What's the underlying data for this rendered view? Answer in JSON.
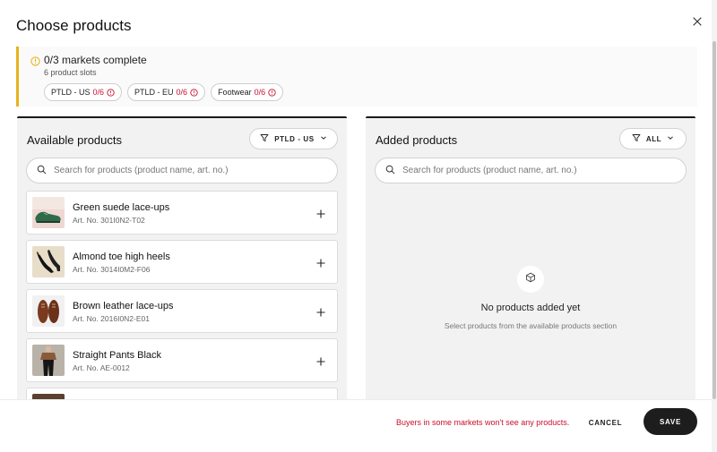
{
  "modal": {
    "title": "Choose products",
    "close_icon": "close-icon"
  },
  "notice": {
    "title": "0/3 markets complete",
    "subtitle": "6 product slots",
    "accent_color": "#e6b31e",
    "markets": [
      {
        "name": "PTLD - US",
        "count": "0/6"
      },
      {
        "name": "PTLD - EU",
        "count": "0/6"
      },
      {
        "name": "Footwear",
        "count": "0/6"
      }
    ]
  },
  "available": {
    "title": "Available products",
    "filter_label": "PTLD - US",
    "search_placeholder": "Search for products (product name, art. no.)",
    "products": [
      {
        "name": "Green suede lace-ups",
        "art": "Art. No. 301I0N2-T02"
      },
      {
        "name": "Almond toe high heels",
        "art": "Art. No. 3014I0M2-F06"
      },
      {
        "name": "Brown leather lace-ups",
        "art": "Art. No. 2016I0N2-E01"
      },
      {
        "name": "Straight Pants Black",
        "art": "Art. No. AE-0012"
      }
    ]
  },
  "added": {
    "title": "Added products",
    "filter_label": "ALL",
    "search_placeholder": "Search for products (product name, art. no.)",
    "empty_title": "No products added yet",
    "empty_subtitle": "Select products from the available products section"
  },
  "footer": {
    "warning": "Buyers in some markets won't see any products.",
    "cancel_label": "CANCEL",
    "save_label": "SAVE",
    "warning_color": "#c8102e"
  }
}
